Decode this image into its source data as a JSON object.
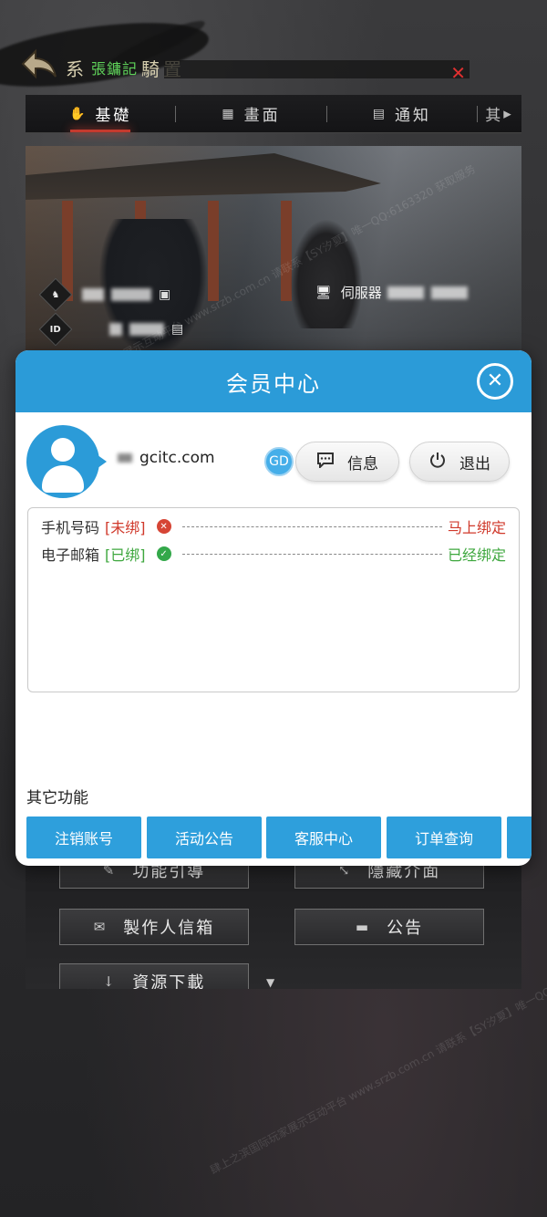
{
  "game": {
    "top_title_left": "系",
    "top_title_green": "張鏞記",
    "top_title_right": "騎置",
    "tabs": [
      {
        "label": "基礎",
        "icon": "hand-icon"
      },
      {
        "label": "畫面",
        "icon": "monitor-icon"
      },
      {
        "label": "通知",
        "icon": "chat-icon"
      },
      {
        "label": "其",
        "icon": "arrow-right-icon"
      }
    ],
    "server_label": "伺服器",
    "id_label": "ID",
    "buttons": [
      {
        "label": "功能引導",
        "icon": "guide-icon"
      },
      {
        "label": "隱藏介面",
        "icon": "resize-icon"
      },
      {
        "label": "製作人信箱",
        "icon": "mail-icon"
      },
      {
        "label": "公告",
        "icon": "bubble-icon"
      },
      {
        "label": "資源下載",
        "icon": "download-icon"
      }
    ],
    "watermark": "肆上之滨国际玩家展示互动平台 www.srzb.com.cn 请联系【SY汐夏】唯一QQ:6163320 获取服务"
  },
  "modal": {
    "title": "会员中心",
    "close_symbol": "✕",
    "account_suffix": "gcitc.com",
    "badge": "GD",
    "message_label": "信息",
    "exit_label": "退出",
    "bindings": [
      {
        "label": "手机号码",
        "status": "[未绑]",
        "state": "unbound",
        "action": "马上绑定"
      },
      {
        "label": "电子邮箱",
        "status": "[已绑]",
        "state": "bound",
        "action": "已经绑定"
      }
    ],
    "other_label": "其它功能",
    "functions": [
      "注销账号",
      "活动公告",
      "客服中心",
      "订单查询"
    ]
  },
  "colors": {
    "accent": "#2b9bd8",
    "unbound": "#d0392b",
    "bound": "#3ea73e"
  }
}
